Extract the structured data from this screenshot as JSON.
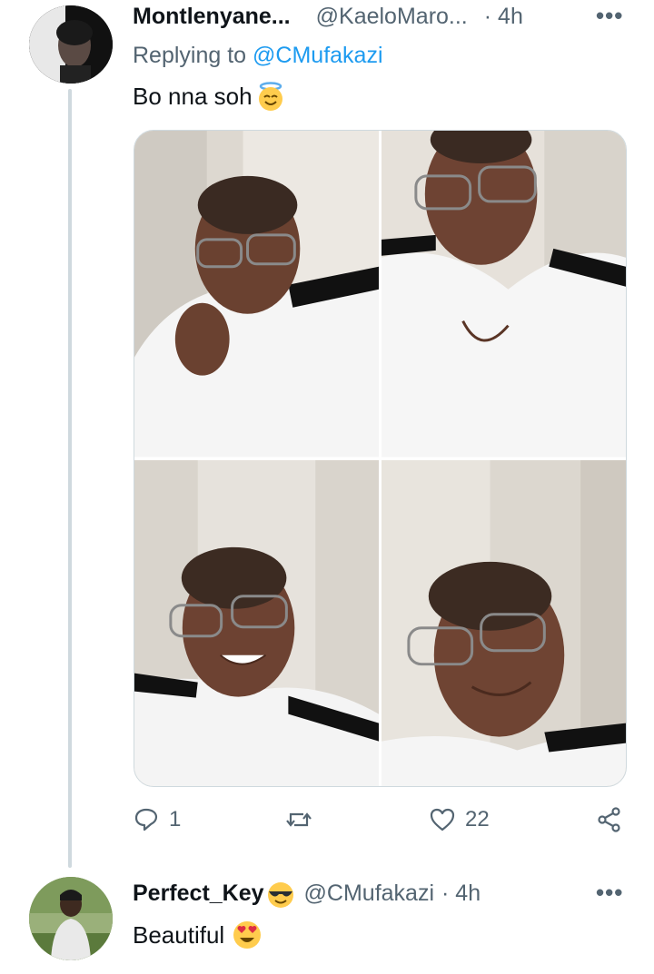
{
  "tweet": {
    "display_name": "Montlenyane...",
    "handle": "@KaeloMaro...",
    "time": "· 4h",
    "more_label": "•••",
    "replying_prefix": "Replying to",
    "replying_to": "@CMufakazi",
    "text": "Bo nna soh",
    "text_emoji": "smiling-face-with-halo",
    "media": {
      "photo_count": 4
    },
    "actions": {
      "reply_count": "1",
      "retweet_count": "",
      "like_count": "22"
    }
  },
  "reply": {
    "display_name": "Perfect_Key",
    "name_emoji": "smiling-face-with-sunglasses",
    "handle": "@CMufakazi",
    "time": "· 4h",
    "more_label": "•••",
    "text": "Beautiful",
    "text_emoji": "smiling-face-with-heart-eyes"
  },
  "colors": {
    "accent": "#1d9bf0",
    "secondary_text": "#536471",
    "thread_line": "#cfd9de"
  }
}
